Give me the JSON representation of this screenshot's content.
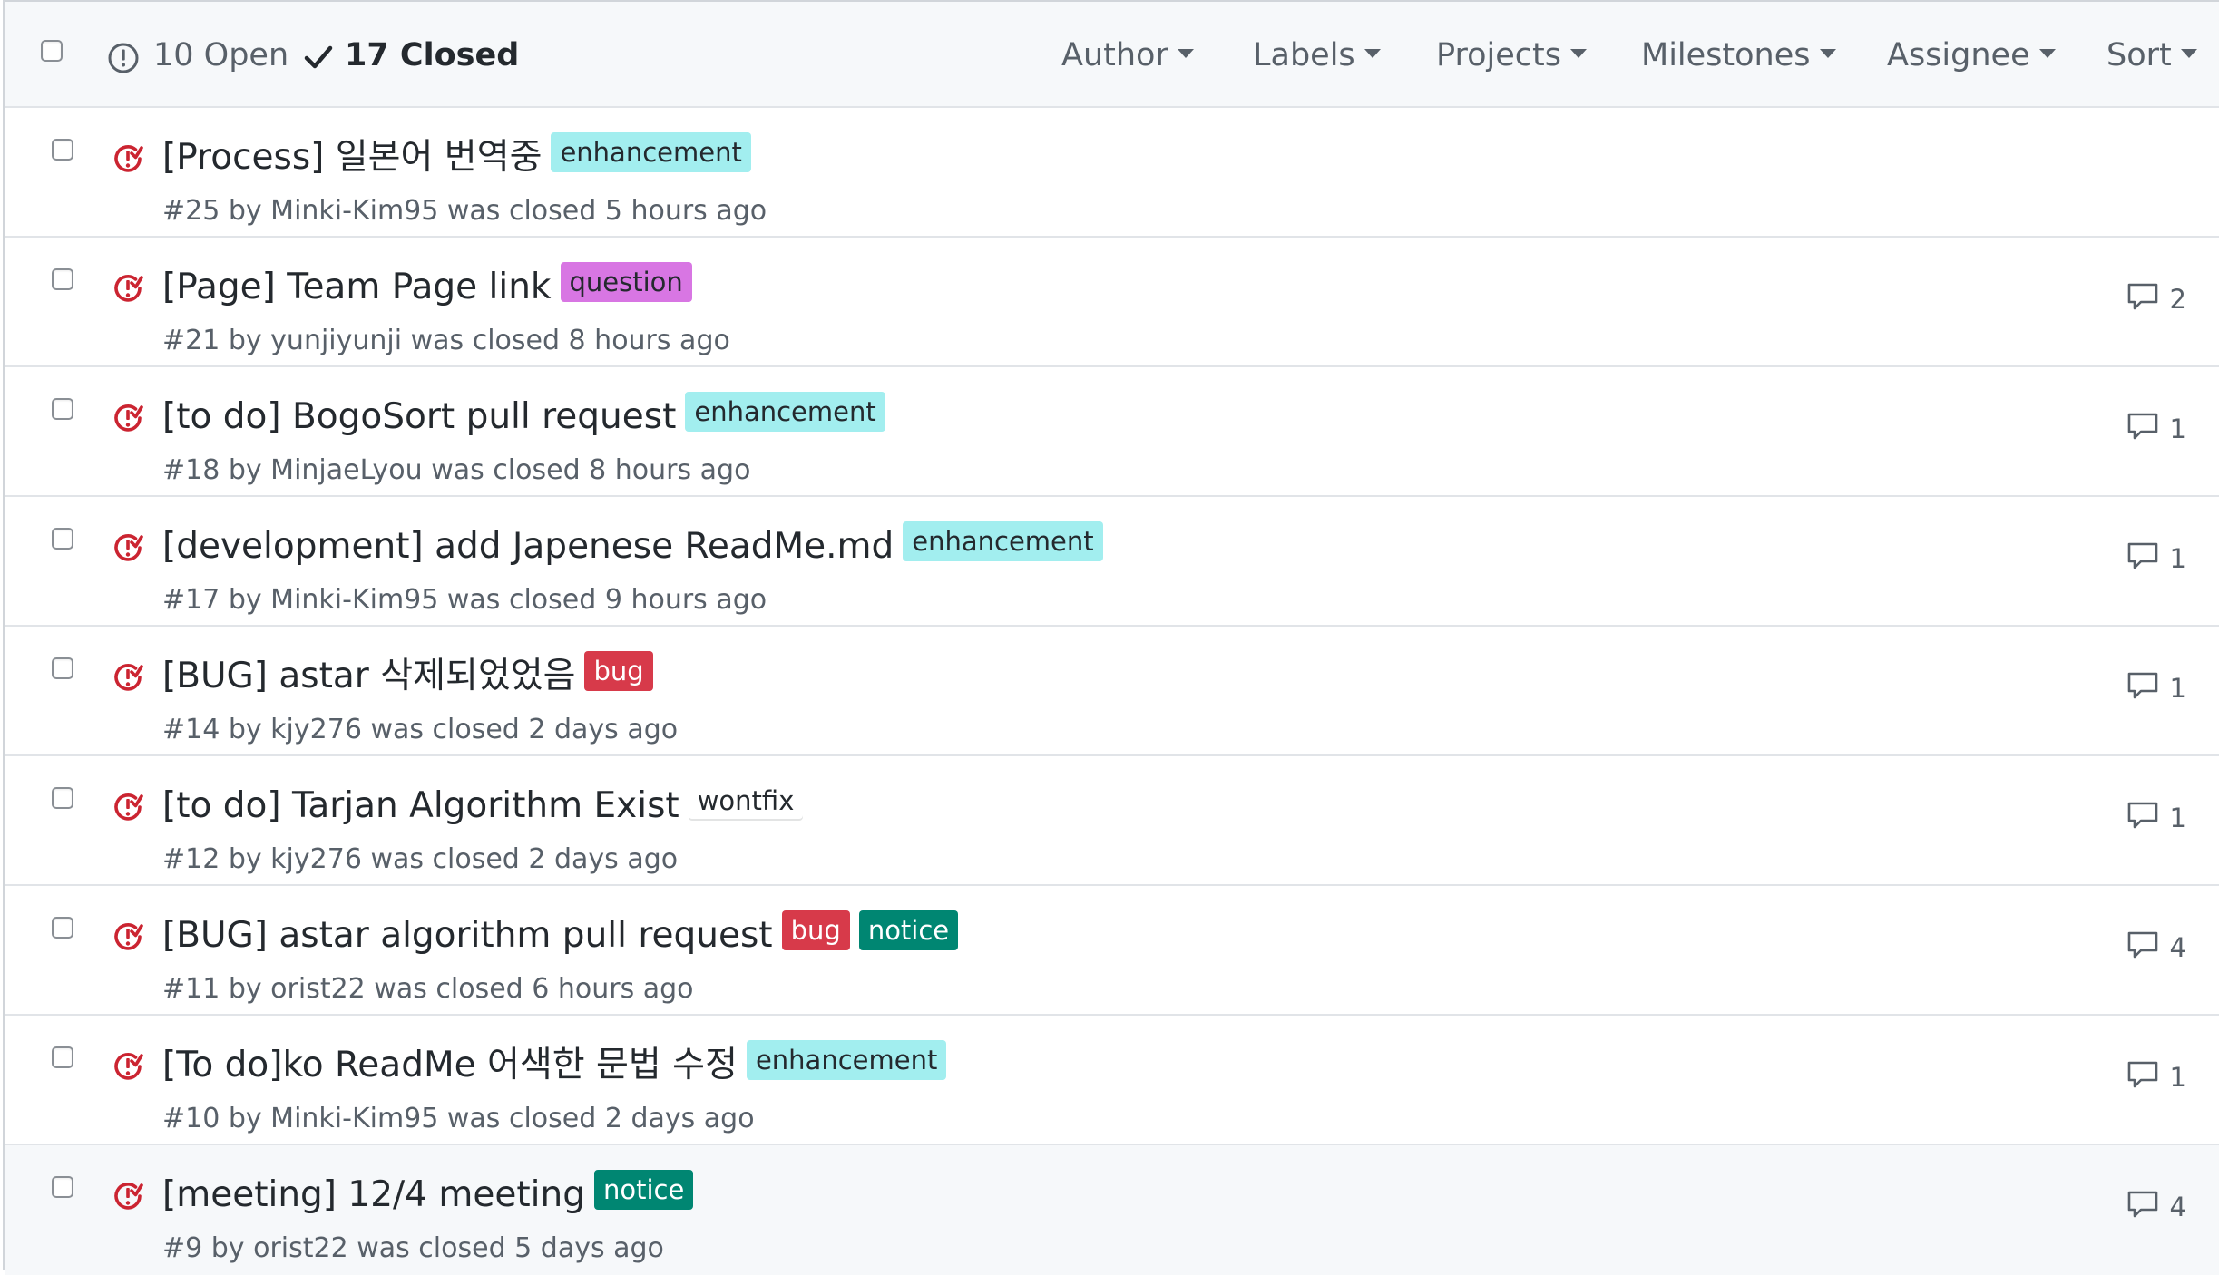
{
  "header": {
    "open_label": "10 Open",
    "closed_label": "17 Closed",
    "filters": [
      "Author",
      "Labels",
      "Projects",
      "Milestones",
      "Assignee",
      "Sort"
    ]
  },
  "colors": {
    "closed_icon": "#cb2431",
    "label_enhancement": "#a2eeef",
    "label_question": "#d876e3",
    "label_bug": "#d73a4a",
    "label_wontfix": "#ffffff",
    "label_notice": "#008672"
  },
  "issues": [
    {
      "title": "[Process] 일본어 번역중",
      "labels": [
        {
          "name": "enhancement",
          "bg": "#a2eeef",
          "fg": "#24292e"
        }
      ],
      "meta": "#25 by Minki-Kim95 was closed 5 hours ago",
      "comments": ""
    },
    {
      "title": "[Page] Team Page link",
      "labels": [
        {
          "name": "question",
          "bg": "#d876e3",
          "fg": "#24292e"
        }
      ],
      "meta": "#21 by yunjiyunji was closed 8 hours ago",
      "comments": "2"
    },
    {
      "title": "[to do] BogoSort pull request",
      "labels": [
        {
          "name": "enhancement",
          "bg": "#a2eeef",
          "fg": "#24292e"
        }
      ],
      "meta": "#18 by MinjaeLyou was closed 8 hours ago",
      "comments": "1"
    },
    {
      "title": "[development] add Japenese ReadMe.md",
      "labels": [
        {
          "name": "enhancement",
          "bg": "#a2eeef",
          "fg": "#24292e"
        }
      ],
      "meta": "#17 by Minki-Kim95 was closed 9 hours ago",
      "comments": "1"
    },
    {
      "title": "[BUG] astar 삭제되었었음",
      "labels": [
        {
          "name": "bug",
          "bg": "#d73a4a",
          "fg": "#ffffff"
        }
      ],
      "meta": "#14 by kjy276 was closed 2 days ago",
      "comments": "1"
    },
    {
      "title": "[to do] Tarjan Algorithm Exist",
      "labels": [
        {
          "name": "wontfix",
          "bg": "#ffffff",
          "fg": "#24292e"
        }
      ],
      "meta": "#12 by kjy276 was closed 2 days ago",
      "comments": "1"
    },
    {
      "title": "[BUG] astar algorithm pull request",
      "labels": [
        {
          "name": "bug",
          "bg": "#d73a4a",
          "fg": "#ffffff"
        },
        {
          "name": "notice",
          "bg": "#008672",
          "fg": "#ffffff"
        }
      ],
      "meta": "#11 by orist22 was closed 6 hours ago",
      "comments": "4"
    },
    {
      "title": "[To do]ko ReadMe 어색한 문법 수정",
      "labels": [
        {
          "name": "enhancement",
          "bg": "#a2eeef",
          "fg": "#24292e"
        }
      ],
      "meta": "#10 by Minki-Kim95 was closed 2 days ago",
      "comments": "1"
    },
    {
      "title": "[meeting] 12/4 meeting",
      "labels": [
        {
          "name": "notice",
          "bg": "#008672",
          "fg": "#ffffff"
        }
      ],
      "meta": "#9 by orist22 was closed 5 days ago",
      "comments": "4"
    }
  ]
}
